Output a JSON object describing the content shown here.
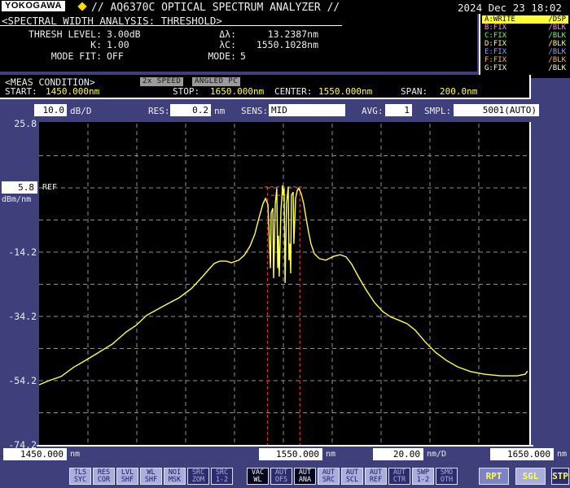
{
  "titlebar": {
    "logo": "YOKOGAWA",
    "title": "// AQ6370C OPTICAL SPECTRUM ANALYZER //",
    "datetime": "2024 Dec 23 18:02"
  },
  "analysis": {
    "header": "<SPECTRAL WIDTH ANALYSIS: THRESHOLD>",
    "rows": [
      {
        "label": "THRESH LEVEL:",
        "value": "3.00dB",
        "label2": "Δλ:",
        "value2": "13.2387nm"
      },
      {
        "label": "K:",
        "value": "1.00",
        "label2": "λC:",
        "value2": "1550.1028nm"
      },
      {
        "label": "MODE FIT:",
        "value": "OFF",
        "label2": "MODE:",
        "value2": "5"
      }
    ]
  },
  "traces": {
    "rows": [
      {
        "name": "A:WRITE",
        "mode": "/DSP",
        "color": "#ffff33",
        "active": true
      },
      {
        "name": "B:FIX",
        "mode": "/BLK",
        "color": "#ff7dff",
        "active": false
      },
      {
        "name": "C:FIX",
        "mode": "/BLK",
        "color": "#6aff6a",
        "active": false
      },
      {
        "name": "D:FIX",
        "mode": "/BLK",
        "color": "#ffff55",
        "active": false
      },
      {
        "name": "E:FIX",
        "mode": "/BLK",
        "color": "#9a9aff",
        "active": false
      },
      {
        "name": "F:FIX",
        "mode": "/BLK",
        "color": "#ffb05a",
        "active": false
      },
      {
        "name": "G:FIX",
        "mode": "/BLK",
        "color": "#ffffb0",
        "active": false
      }
    ]
  },
  "meas": {
    "header": "<MEAS CONDITION>",
    "badges": [
      "2x SPEED",
      "ANGLED PC"
    ],
    "items": [
      {
        "label": "START:",
        "value": "1450.000nm"
      },
      {
        "label": "STOP:",
        "value": "1650.000nm"
      },
      {
        "label": "CENTER:",
        "value": "1550.000nm"
      },
      {
        "label": "SPAN:",
        "value": "200.0nm"
      }
    ]
  },
  "settings": {
    "level_scale": "10.0",
    "level_unit": "dB/D",
    "res_label": "RES:",
    "res_value": "0.2",
    "res_unit": "nm",
    "sens_label": "SENS:",
    "sens_value": "MID",
    "avg_label": "AVG:",
    "avg_value": "1",
    "smpl_label": "SMPL:",
    "smpl_value": "5001(AUTO)"
  },
  "plot": {
    "y_ticks": [
      {
        "text": "25.8",
        "dbm": 25.8
      },
      {
        "text": "-14.2",
        "dbm": -14.2
      },
      {
        "text": "-34.2",
        "dbm": -34.2
      },
      {
        "text": "-54.2",
        "dbm": -54.2
      },
      {
        "text": "-74.2",
        "dbm": -74.2
      }
    ],
    "ref": {
      "value": "5.8",
      "label": "REF",
      "unit": "dBm/nm"
    },
    "x_labels": [
      {
        "value": "1450.000",
        "suffix": "nm"
      },
      {
        "value": "1550.000",
        "suffix": "nm"
      },
      {
        "value": "20.00",
        "suffix": "nm/D"
      },
      {
        "value": "1650.000",
        "suffix": "nm"
      }
    ]
  },
  "chart_data": {
    "type": "line",
    "xlabel": "nm",
    "ylabel": "dBm/nm",
    "xlim": [
      1450,
      1650
    ],
    "ylim": [
      -74.2,
      25.8
    ],
    "x_per_div": 20.0,
    "y_per_div": 10.0,
    "ref_level_dbm": 5.8,
    "grid": true,
    "grid_color": "#8f8f8f",
    "series": [
      {
        "name": "TRACE A",
        "color": "#ffff4d",
        "points": [
          [
            1450,
            -55.5
          ],
          [
            1454,
            -54.2
          ],
          [
            1459,
            -52.9
          ],
          [
            1464,
            -50.1
          ],
          [
            1469.7,
            -47.6
          ],
          [
            1474,
            -45.6
          ],
          [
            1480,
            -42.8
          ],
          [
            1485.7,
            -39.0
          ],
          [
            1489.7,
            -37.0
          ],
          [
            1494,
            -33.9
          ],
          [
            1498,
            -32.2
          ],
          [
            1502.3,
            -30.4
          ],
          [
            1507.3,
            -28.4
          ],
          [
            1512.3,
            -25.6
          ],
          [
            1515.7,
            -22.8
          ],
          [
            1519,
            -20.0
          ],
          [
            1521.7,
            -17.7
          ],
          [
            1524,
            -17.0
          ],
          [
            1526.7,
            -17.0
          ],
          [
            1528.7,
            -17.5
          ],
          [
            1531.7,
            -16.7
          ],
          [
            1534,
            -15.2
          ],
          [
            1536.3,
            -12.4
          ],
          [
            1538.3,
            -8.6
          ],
          [
            1540,
            -3.6
          ],
          [
            1541.7,
            1.0
          ],
          [
            1542.7,
            2.5
          ],
          [
            1543.7,
            0.5
          ],
          [
            1544.3,
            -11.6
          ],
          [
            1544.7,
            -19.2
          ],
          [
            1545,
            -2.0
          ],
          [
            1545.7,
            -0.5
          ],
          [
            1546,
            -22.3
          ],
          [
            1546.3,
            -11.6
          ],
          [
            1546.7,
            1.0
          ],
          [
            1547.3,
            5.6
          ],
          [
            1547.7,
            -19.2
          ],
          [
            1548,
            -9.1
          ],
          [
            1548.3,
            -21.8
          ],
          [
            1549,
            -1.5
          ],
          [
            1549.7,
            6.6
          ],
          [
            1550,
            3.5
          ],
          [
            1550.3,
            5.6
          ],
          [
            1550.7,
            -23.8
          ],
          [
            1551.3,
            1.0
          ],
          [
            1552,
            6.1
          ],
          [
            1552.3,
            -16.7
          ],
          [
            1552.7,
            -11.6
          ],
          [
            1553,
            -20.8
          ],
          [
            1553.3,
            3.5
          ],
          [
            1554,
            4.5
          ],
          [
            1554.3,
            -11.6
          ],
          [
            1555,
            2.5
          ],
          [
            1555.7,
            5.1
          ],
          [
            1556.3,
            5.6
          ],
          [
            1557.3,
            4.0
          ],
          [
            1558.3,
            1.0
          ],
          [
            1559.3,
            -3.6
          ],
          [
            1560.3,
            -7.9
          ],
          [
            1561.3,
            -11.6
          ],
          [
            1562.7,
            -14.7
          ],
          [
            1564.7,
            -16.2
          ],
          [
            1567.3,
            -16.7
          ],
          [
            1570.7,
            -15.5
          ],
          [
            1573.3,
            -15.0
          ],
          [
            1575.7,
            -15.7
          ],
          [
            1578,
            -18.0
          ],
          [
            1580.7,
            -21.8
          ],
          [
            1584,
            -26.1
          ],
          [
            1587.3,
            -29.9
          ],
          [
            1590.7,
            -32.7
          ],
          [
            1594,
            -34.4
          ],
          [
            1597.3,
            -35.4
          ],
          [
            1600.7,
            -36.5
          ],
          [
            1604,
            -38.5
          ],
          [
            1608,
            -42.1
          ],
          [
            1612.3,
            -45.4
          ],
          [
            1616.7,
            -47.9
          ],
          [
            1621.3,
            -49.9
          ],
          [
            1626.7,
            -51.4
          ],
          [
            1632.3,
            -52.2
          ],
          [
            1639,
            -52.7
          ],
          [
            1645.7,
            -52.7
          ],
          [
            1649,
            -52.2
          ],
          [
            1650,
            -51.2
          ]
        ]
      }
    ],
    "markers": {
      "color": "#cc3333",
      "width_left_nm": 1543.5,
      "width_right_nm": 1556.74,
      "top_line_dbm": 6.1,
      "top_line_nm": [
        1542.3,
        1557.9
      ],
      "threshold_line_dbm": 3.5,
      "threshold_line_nm": [
        1545.0,
        1551.0
      ]
    }
  },
  "softkeys": [
    {
      "line1": "TLS",
      "line2": "SYC",
      "style": "light"
    },
    {
      "line1": "RES",
      "line2": "COR",
      "style": "light"
    },
    {
      "line1": "LVL",
      "line2": "SHF",
      "style": "light"
    },
    {
      "line1": "WL",
      "line2": "SHF",
      "style": "light"
    },
    {
      "line1": "NOI",
      "line2": "MSK",
      "style": "light"
    },
    {
      "line1": "SRC",
      "line2": "ZOM",
      "style": "dark"
    },
    {
      "line1": "SRC",
      "line2": "1-2",
      "style": "dark"
    },
    {
      "line1": "VAC",
      "line2": "WL",
      "style": "black"
    },
    {
      "line1": "AUT",
      "line2": "OFS",
      "style": "dark"
    },
    {
      "line1": "AUT",
      "line2": "ANA",
      "style": "black"
    },
    {
      "line1": "AUT",
      "line2": "SRC",
      "style": "light"
    },
    {
      "line1": "AUT",
      "line2": "SCL",
      "style": "light"
    },
    {
      "line1": "AUT",
      "line2": "REF",
      "style": "light"
    },
    {
      "line1": "AUT",
      "line2": "CTR",
      "style": "dark"
    },
    {
      "line1": "SWP",
      "line2": "1-2",
      "style": "light"
    },
    {
      "line1": "SMO",
      "line2": "OTH",
      "style": "dark"
    }
  ],
  "run_keys": [
    {
      "label": "RPT",
      "style": "medium"
    },
    {
      "label": "SGL",
      "style": "light"
    },
    {
      "label": "STP",
      "style": "dark"
    }
  ],
  "colors": {
    "background": "#3f3f7c",
    "panel": "#000000",
    "accent_yellow": "#ffff4d",
    "trace": "#ffff4d",
    "marker_red": "#cc3333",
    "grid": "#8f8f8f",
    "active_trace_bg": "#ffff33"
  }
}
